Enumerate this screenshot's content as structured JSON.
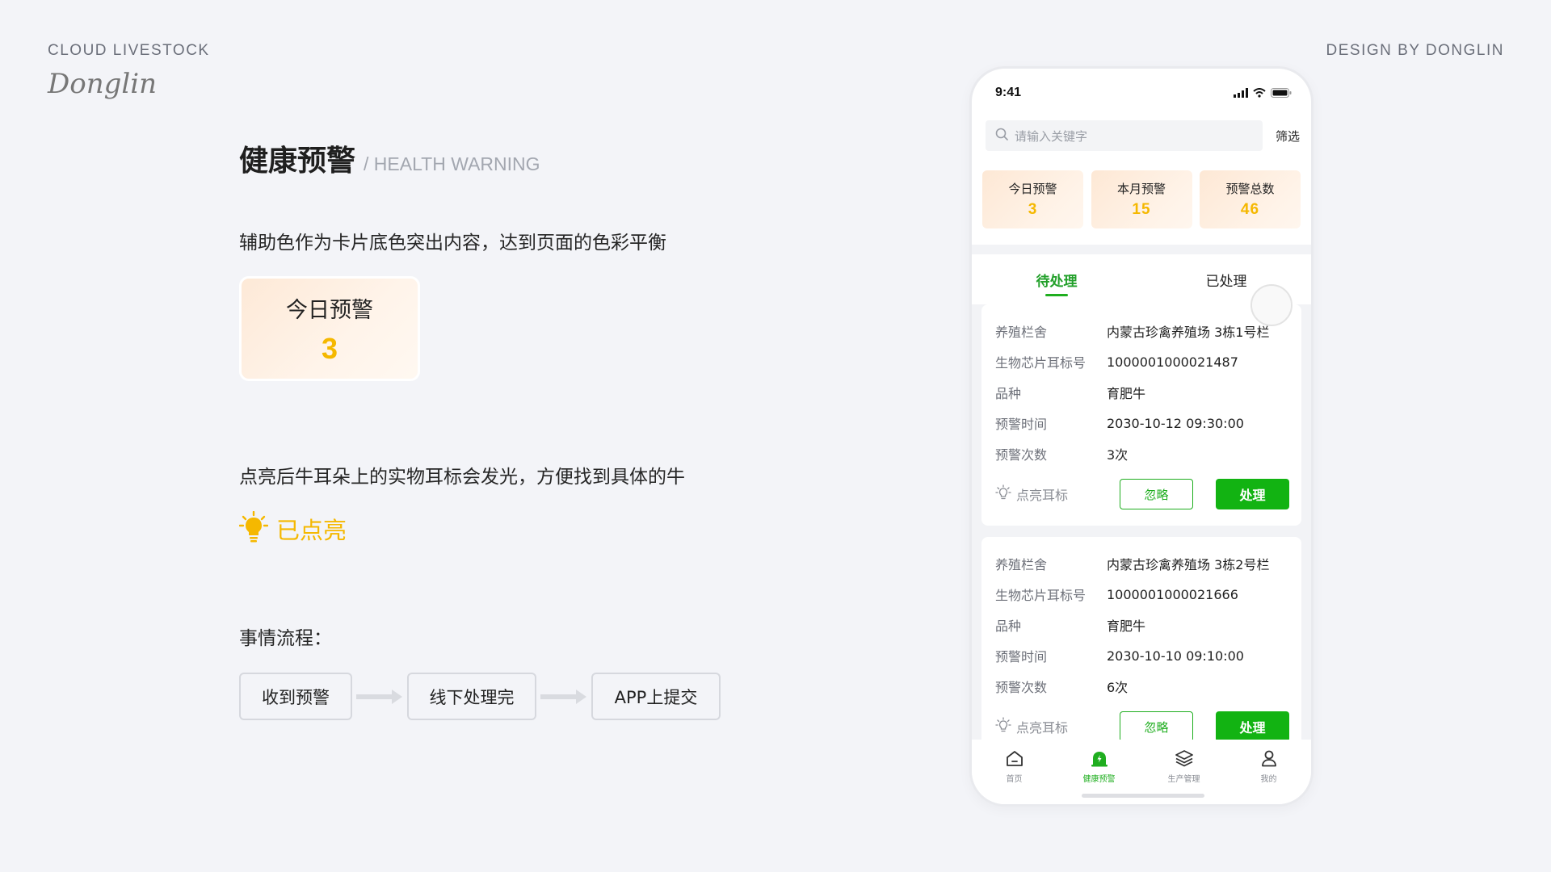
{
  "header": {
    "brand": "CLOUD LIVESTOCK",
    "signature": "Donglin",
    "credit": "DESIGN BY DONGLIN"
  },
  "section": {
    "title_zh": "健康预警",
    "title_en": "/ HEALTH WARNING",
    "desc_color": "辅助色作为卡片底色突出内容，达到页面的色彩平衡",
    "demo_card": {
      "label": "今日预警",
      "value": "3"
    },
    "desc_light": "点亮后牛耳朵上的实物耳标会发光，方便找到具体的牛",
    "lit_label": "已点亮",
    "desc_flow": "事情流程：",
    "flow": [
      "收到预警",
      "线下处理完",
      "APP上提交"
    ]
  },
  "phone": {
    "time": "9:41",
    "search_placeholder": "请输入关键字",
    "filter": "筛选",
    "stats": [
      {
        "label": "今日预警",
        "value": "3"
      },
      {
        "label": "本月预警",
        "value": "15"
      },
      {
        "label": "预警总数",
        "value": "46"
      }
    ],
    "tabs": [
      {
        "label": "待处理",
        "active": true
      },
      {
        "label": "已处理",
        "active": false
      }
    ],
    "cards": [
      {
        "rows": [
          {
            "k": "养殖栏舍",
            "v": "内蒙古珍禽养殖场 3栋1号栏"
          },
          {
            "k": "生物芯片耳标号",
            "v": "1000001000021487"
          },
          {
            "k": "品种",
            "v": "育肥牛"
          },
          {
            "k": "预警时间",
            "v": "2030-10-12  09:30:00"
          },
          {
            "k": "预警次数",
            "v": "3次"
          }
        ],
        "light": "点亮耳标",
        "ignore": "忽略",
        "handle": "处理"
      },
      {
        "rows": [
          {
            "k": "养殖栏舍",
            "v": "内蒙古珍禽养殖场 3栋2号栏"
          },
          {
            "k": "生物芯片耳标号",
            "v": "1000001000021666"
          },
          {
            "k": "品种",
            "v": "育肥牛"
          },
          {
            "k": "预警时间",
            "v": "2030-10-10  09:10:00"
          },
          {
            "k": "预警次数",
            "v": "6次"
          }
        ],
        "light": "点亮耳标",
        "ignore": "忽略",
        "handle": "处理"
      }
    ],
    "tabbar": [
      {
        "label": "首页",
        "icon": "home-icon"
      },
      {
        "label": "健康预警",
        "icon": "alert-icon",
        "active": true
      },
      {
        "label": "生产管理",
        "icon": "layers-icon"
      },
      {
        "label": "我的",
        "icon": "user-icon"
      }
    ]
  },
  "colors": {
    "accent_green": "#1fae1f",
    "highlight_yellow": "#f5b800",
    "card_bg": "#fdeadb"
  }
}
